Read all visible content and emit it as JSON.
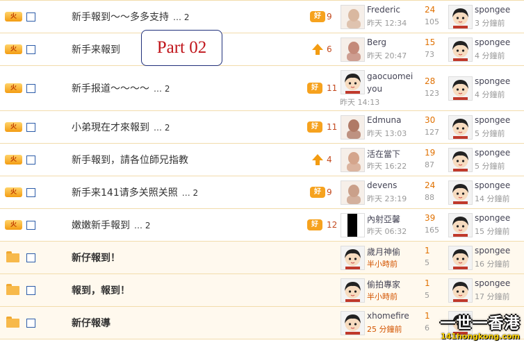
{
  "annotation": "Part 02",
  "watermark": {
    "line1": "一世一香港",
    "line2": "141hongkong.com"
  },
  "threads": [
    {
      "icon": "hot",
      "title": "新手報到～～多多支持",
      "pages": "… 2",
      "bold": false,
      "badge": "good",
      "score": "9",
      "poster": "Frederic",
      "post_time": "昨天 12:34",
      "replies": "24",
      "views": "105",
      "last_poster": "spongee",
      "last_time": "3 分鐘前"
    },
    {
      "icon": "hot",
      "title": "新手来報到",
      "pages": "",
      "bold": false,
      "badge": "up",
      "score": "6",
      "poster": "Berg",
      "post_time": "昨天 20:47",
      "replies": "15",
      "views": "73",
      "last_poster": "spongee",
      "last_time": "4 分鐘前"
    },
    {
      "icon": "hot",
      "title": "新手报道～～～～",
      "pages": "… 2",
      "bold": false,
      "badge": "good",
      "score": "11",
      "poster": "gaocuomei you",
      "post_time": "昨天 14:13",
      "replies": "28",
      "views": "123",
      "last_poster": "spongee",
      "last_time": "4 分鐘前"
    },
    {
      "icon": "hot",
      "title": "小弟現在才來報到",
      "pages": "… 2",
      "bold": false,
      "badge": "good",
      "score": "11",
      "poster": "Edmuna",
      "post_time": "昨天 13:03",
      "replies": "30",
      "views": "127",
      "last_poster": "spongee",
      "last_time": "5 分鐘前"
    },
    {
      "icon": "hot",
      "title": "新手報到，請各位師兄指教",
      "pages": "",
      "bold": false,
      "badge": "up",
      "score": "4",
      "poster": "活在當下",
      "post_time": "昨天 16:22",
      "replies": "19",
      "views": "87",
      "last_poster": "spongee",
      "last_time": "5 分鐘前"
    },
    {
      "icon": "hot",
      "title": "新手来141请多关照关照",
      "pages": "… 2",
      "bold": false,
      "badge": "good",
      "score": "9",
      "poster": "devens",
      "post_time": "昨天 23:19",
      "replies": "24",
      "views": "88",
      "last_poster": "spongee",
      "last_time": "14 分鐘前"
    },
    {
      "icon": "hot",
      "title": "嫩嫩新手報到",
      "pages": "… 2",
      "bold": false,
      "badge": "good",
      "score": "12",
      "poster": "內射亞馨",
      "post_time": "昨天 06:32",
      "replies": "39",
      "views": "165",
      "last_poster": "spongee",
      "last_time": "15 分鐘前"
    },
    {
      "icon": "folder",
      "title": "新仔報到！",
      "pages": "",
      "bold": true,
      "badge": "",
      "score": "",
      "poster": "歲月神偷",
      "post_time": "半小時前",
      "replies": "1",
      "views": "5",
      "last_poster": "spongee",
      "last_time": "16 分鐘前"
    },
    {
      "icon": "folder",
      "title": "報到，報到！",
      "pages": "",
      "bold": true,
      "badge": "",
      "score": "",
      "poster": "偷拍專家",
      "post_time": "半小時前",
      "replies": "1",
      "views": "5",
      "last_poster": "spongee",
      "last_time": "17 分鐘前"
    },
    {
      "icon": "folder",
      "title": "新仔報導",
      "pages": "",
      "bold": true,
      "badge": "",
      "score": "",
      "poster": "xhomefire",
      "post_time": "25 分鐘前",
      "replies": "1",
      "views": "6",
      "last_poster": "",
      "last_time": ""
    }
  ],
  "icon_labels": {
    "hot": "火",
    "good": "好"
  },
  "colors": {
    "accent": "#f6a21e",
    "border": "#f2dcab",
    "link": "#2b5ba8",
    "reply": "#e07000"
  }
}
